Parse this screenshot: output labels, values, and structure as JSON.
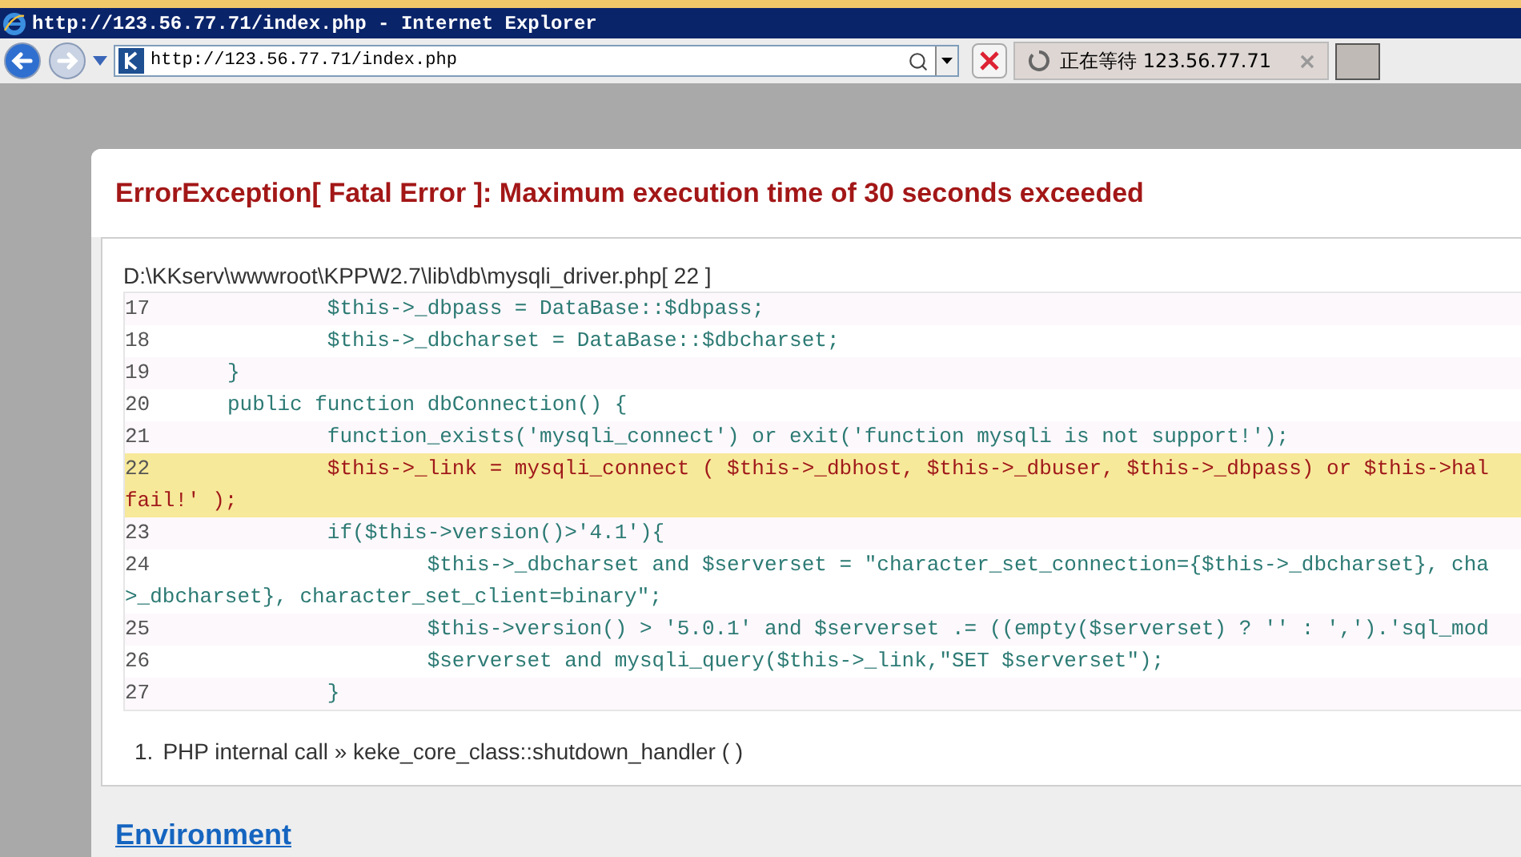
{
  "window": {
    "title": "http://123.56.77.71/index.php - Internet Explorer"
  },
  "address_bar": {
    "value": "http://123.56.77.71/index.php"
  },
  "tabs": [
    {
      "label": "正在等待 123.56.77.71",
      "selected": true
    }
  ],
  "error": {
    "heading": "ErrorException[ Fatal Error ]: Maximum execution time of 30 seconds exceeded",
    "file": "D:\\KKserv\\wwwroot\\KPPW2.7\\lib\\db\\mysqli_driver.php[ 22 ]",
    "lines": [
      {
        "number": "17",
        "highlighted": false,
        "text": [
          "        $this->_dbpass = DataBase::$dbpass;"
        ]
      },
      {
        "number": "18",
        "highlighted": false,
        "text": [
          "        $this->_dbcharset = DataBase::$dbcharset;"
        ]
      },
      {
        "number": "19",
        "highlighted": false,
        "text": [
          "}"
        ]
      },
      {
        "number": "20",
        "highlighted": false,
        "text": [
          "public function dbConnection() {"
        ]
      },
      {
        "number": "21",
        "highlighted": false,
        "text": [
          "        function_exists('mysqli_connect') or exit('function mysqli is not support!');"
        ]
      },
      {
        "number": "22",
        "highlighted": true,
        "text": [
          "        $this->_link = mysqli_connect ( $this->_dbhost, $this->_dbuser, $this->_dbpass) or $this->hal",
          "fail!' );"
        ]
      },
      {
        "number": "23",
        "highlighted": false,
        "text": [
          "        if($this->version()>'4.1'){"
        ]
      },
      {
        "number": "24",
        "highlighted": false,
        "text": [
          "                $this->_dbcharset and $serverset = \"character_set_connection={$this->_dbcharset}, cha",
          ">_dbcharset}, character_set_client=binary\";"
        ]
      },
      {
        "number": "25",
        "highlighted": false,
        "text": [
          "                $this->version() > '5.0.1' and $serverset .= ((empty($serverset) ? '' : ',').'sql_mod"
        ]
      },
      {
        "number": "26",
        "highlighted": false,
        "text": [
          "                $serverset and mysqli_query($this->_link,\"SET $serverset\");"
        ]
      },
      {
        "number": "27",
        "highlighted": false,
        "text": [
          "        }"
        ]
      }
    ],
    "trace": [
      {
        "index": "1.",
        "text": "PHP internal call » keke_core_class::shutdown_handler ( )"
      }
    ]
  },
  "section_link": "Environment"
}
